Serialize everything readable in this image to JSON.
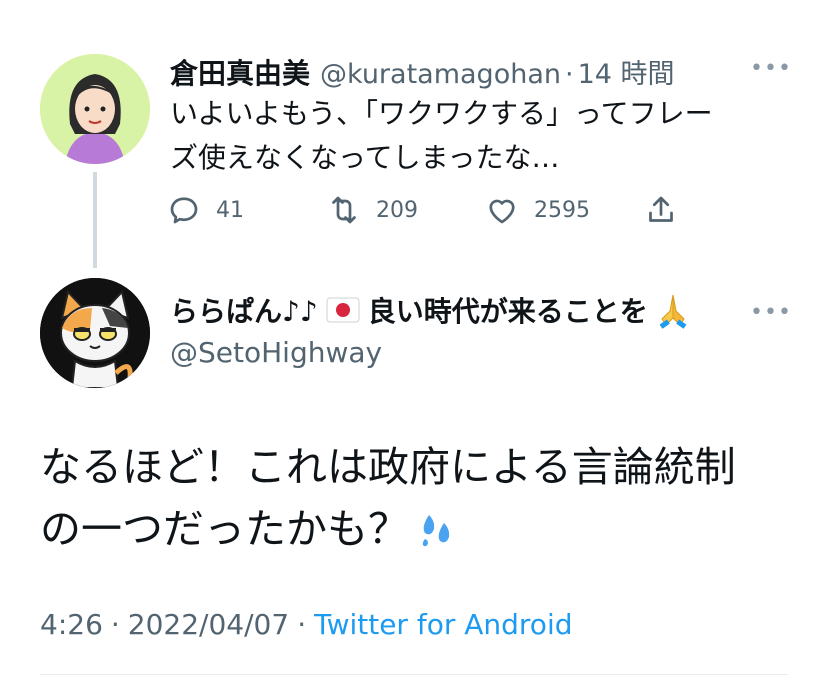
{
  "quoted": {
    "name": "倉田真由美",
    "handle": "@kuratamagohan",
    "sep": "·",
    "time": "14 時間",
    "text_line1": "いよいよもう、「ワクワクする」ってフレー",
    "text_line2": "ズ使えなくなってしまったな…",
    "replies": "41",
    "retweets": "209",
    "likes": "2595",
    "more": "•••"
  },
  "reply": {
    "name": "ららぱん♪♪",
    "name_suffix": "良い時代が来ることを",
    "handle": "@SetoHighway",
    "text_line1": "なるほど！これは政府による言論統制",
    "text_line2": "の一つだったかも？",
    "more": "•••",
    "meta": {
      "time": "4:26",
      "sep1": "·",
      "date": "2022/04/07",
      "sep2": "·",
      "client": "Twitter for Android"
    }
  },
  "icons": [
    "avatar-woman",
    "reply-icon",
    "retweet-icon",
    "like-icon",
    "share-icon",
    "avatar-cat",
    "japan-flag-icon",
    "praying-hands-icon",
    "sweat-droplets-icon",
    "more-icon"
  ],
  "colors": {
    "accent": "#1d9bf0",
    "muted": "#536471",
    "thread": "#cfd9de"
  }
}
